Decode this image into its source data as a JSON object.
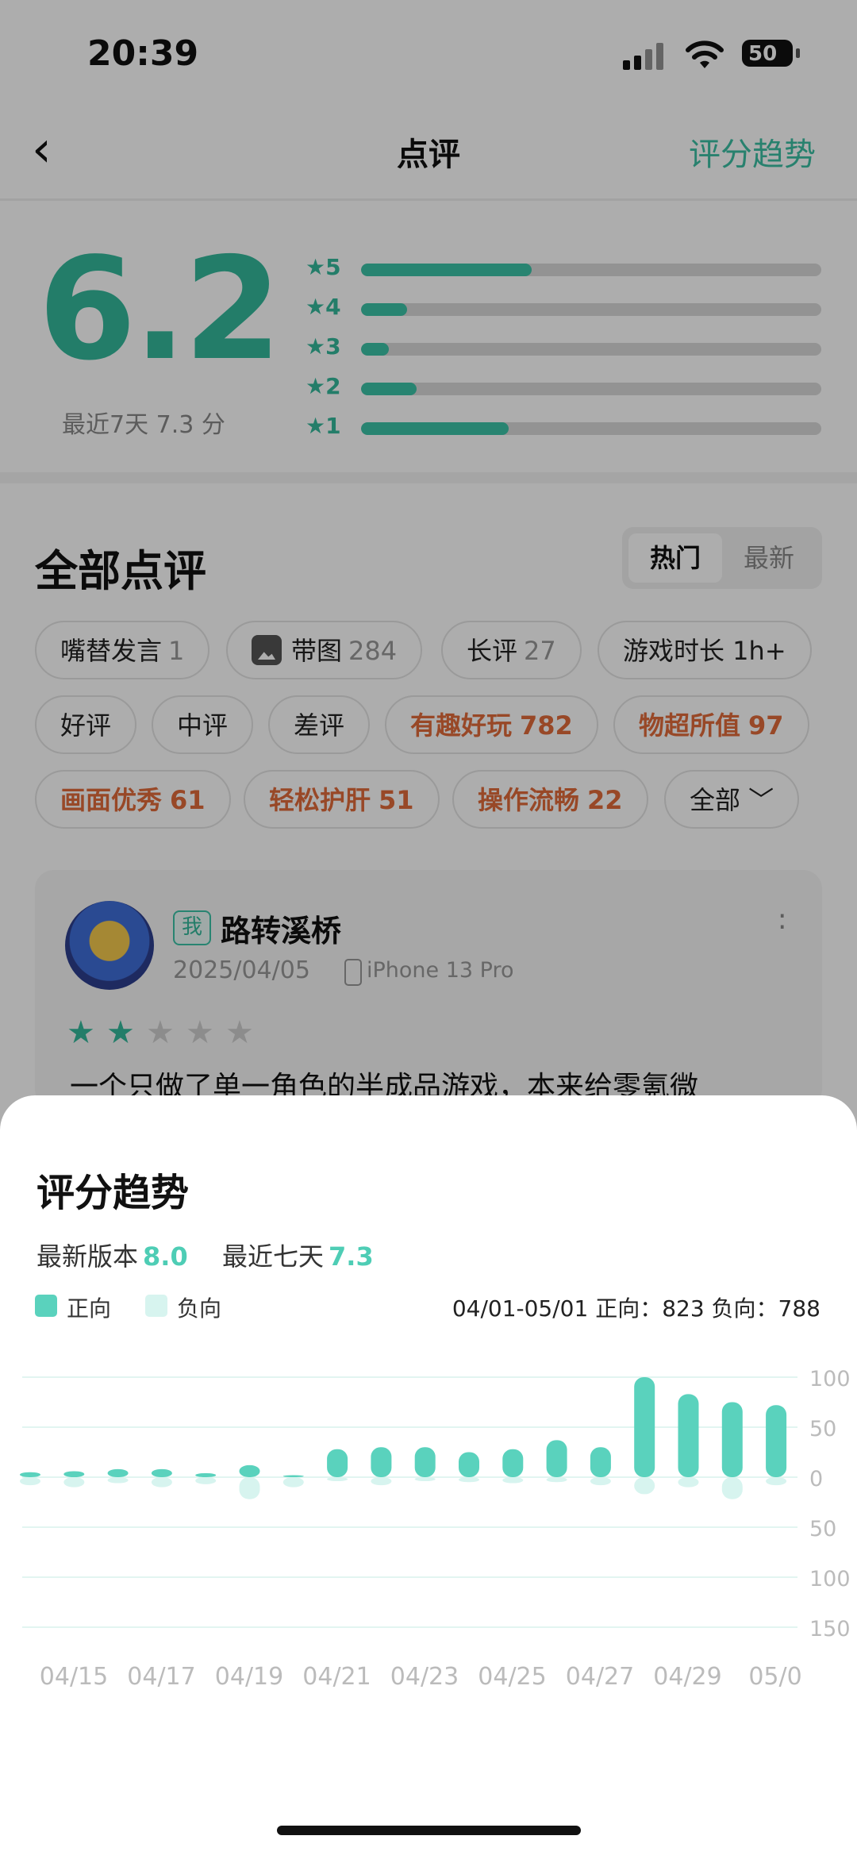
{
  "status_bar": {
    "time": "20:39",
    "battery": "50"
  },
  "nav": {
    "back_icon": "chevron-left-icon",
    "title": "点评",
    "action": "评分趋势"
  },
  "rating": {
    "score": "6.2",
    "recent": "最近7天 7.3 分",
    "distribution": [
      {
        "label": "★5",
        "fraction": 0.37
      },
      {
        "label": "★4",
        "fraction": 0.1
      },
      {
        "label": "★3",
        "fraction": 0.06
      },
      {
        "label": "★2",
        "fraction": 0.12
      },
      {
        "label": "★1",
        "fraction": 0.32
      }
    ]
  },
  "reviews": {
    "title": "全部点评",
    "sort_options": [
      "热门",
      "最新"
    ],
    "tags_row1": [
      {
        "label": "嘴替发言",
        "count": "1"
      },
      {
        "label": "带图",
        "count": "284",
        "icon": "image-icon"
      },
      {
        "label": "长评",
        "count": "27"
      },
      {
        "label": "游戏时长 1h+",
        "count": ""
      }
    ],
    "tags_row2": [
      {
        "label": "好评",
        "count": ""
      },
      {
        "label": "中评",
        "count": ""
      },
      {
        "label": "差评",
        "count": ""
      },
      {
        "label": "有趣好玩",
        "count": "782"
      },
      {
        "label": "物超所值",
        "count": "97"
      }
    ],
    "tags_row3": [
      {
        "label": "画面优秀",
        "count": "61"
      },
      {
        "label": "轻松护肝",
        "count": "51"
      },
      {
        "label": "操作流畅",
        "count": "22"
      },
      {
        "label": "全部 ﹀",
        "count": ""
      }
    ],
    "first_review": {
      "badge": "我",
      "user": "路转溪桥",
      "date": "2025/04/05",
      "device": "iPhone 13 Pro",
      "stars": 2,
      "text": "一个只做了单一角色的半成品游戏，本来给零氪微"
    }
  },
  "trend_sheet": {
    "title": "评分趋势",
    "latest_version_label": "最新版本",
    "latest_version_value": "8.0",
    "last7_label": "最近七天",
    "last7_value": "7.3",
    "legend_positive": "正向",
    "legend_negative": "负向",
    "summary": "04/01-05/01 正向：823 负向：788",
    "colors": {
      "positive": "#5ad2bd",
      "negative": "#d7f4ef"
    }
  },
  "chart_data": {
    "type": "bar",
    "x_labels": [
      "04/15",
      "04/17",
      "04/19",
      "04/21",
      "04/23",
      "04/25",
      "04/27",
      "04/29",
      "05/0"
    ],
    "y_ticks": [
      "100",
      "50",
      "0",
      "50",
      "100",
      "150"
    ],
    "ylim": [
      -150,
      100
    ],
    "series": [
      {
        "name": "正向",
        "values": [
          5,
          6,
          8,
          8,
          4,
          12,
          2,
          28,
          30,
          30,
          25,
          28,
          37,
          30,
          100,
          83,
          75,
          72
        ]
      },
      {
        "name": "负向",
        "values": [
          -8,
          -10,
          -6,
          -10,
          -7,
          -22,
          -10,
          -4,
          -8,
          -4,
          -5,
          -6,
          -5,
          -8,
          -17,
          -10,
          -22,
          -8
        ]
      }
    ]
  }
}
